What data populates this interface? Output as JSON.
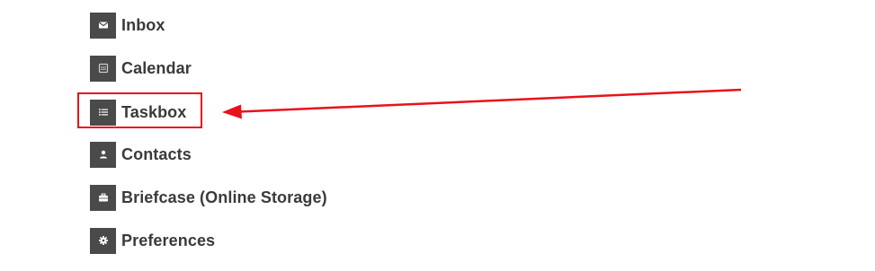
{
  "menu": {
    "items": [
      {
        "label": "Inbox",
        "icon": "envelope-icon"
      },
      {
        "label": "Calendar",
        "icon": "calendar-icon"
      },
      {
        "label": "Taskbox",
        "icon": "task-list-icon"
      },
      {
        "label": "Contacts",
        "icon": "person-icon"
      },
      {
        "label": "Briefcase (Online Storage)",
        "icon": "briefcase-icon"
      },
      {
        "label": "Preferences",
        "icon": "gear-icon"
      }
    ]
  },
  "annotation": {
    "highlighted_item": "Taskbox",
    "color": "#e8121b"
  },
  "colors": {
    "icon_background": "#4a4a4a",
    "label_text": "#3a3a3a",
    "background": "#ffffff"
  }
}
